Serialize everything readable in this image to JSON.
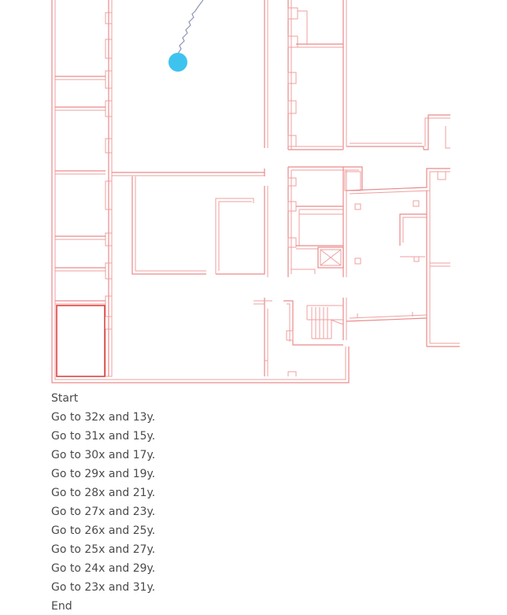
{
  "map": {
    "colors": {
      "walls": "#e98a8a",
      "walls_dark": "#d94545",
      "route": "#8e93b3",
      "position_marker": "#3ec3ef"
    },
    "icons": [
      "position-marker-icon",
      "elevator-icon",
      "stairs-icon"
    ]
  },
  "directions": {
    "start_label": "Start",
    "steps": [
      "Go to 32x and 13y.",
      "Go to 31x and 15y.",
      "Go to 30x and 17y.",
      "Go to 29x and 19y.",
      "Go to 28x and 21y.",
      "Go to 27x and 23y.",
      "Go to 26x and 25y.",
      "Go to 25x and 27y.",
      "Go to 24x and 29y.",
      "Go to 23x and 31y."
    ],
    "end_label": "End"
  }
}
